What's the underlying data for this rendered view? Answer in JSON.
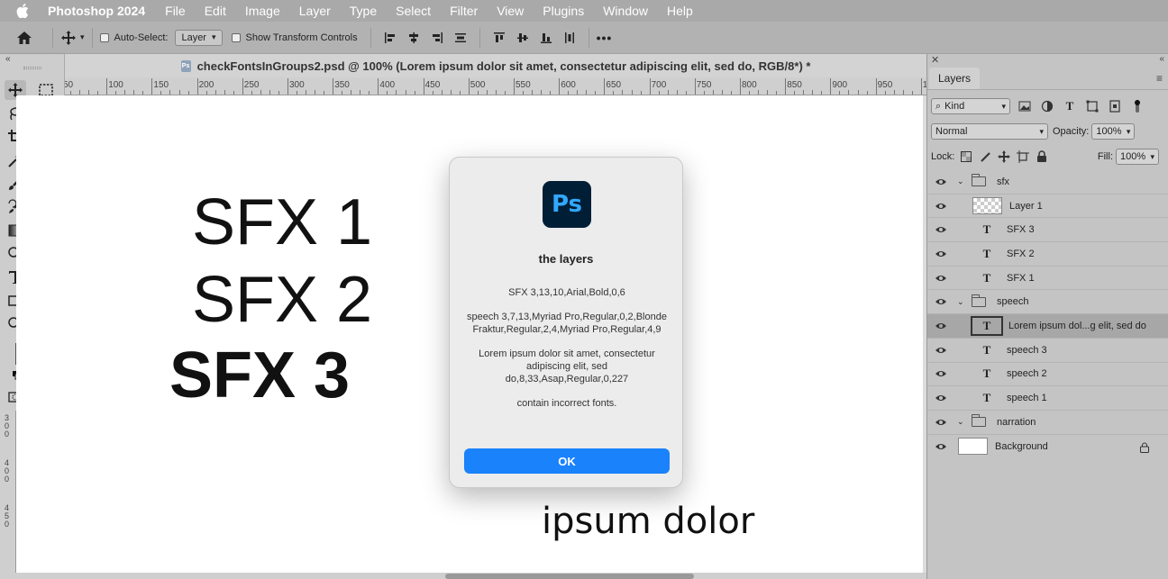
{
  "menubar": {
    "app_name": "Photoshop 2024",
    "items": [
      "File",
      "Edit",
      "Image",
      "Layer",
      "Type",
      "Select",
      "Filter",
      "View",
      "Plugins",
      "Window",
      "Help"
    ]
  },
  "options_bar": {
    "auto_select_label": "Auto-Select:",
    "auto_select_value": "Layer",
    "transform_controls_label": "Show Transform Controls",
    "more_label": "•••"
  },
  "document": {
    "tab_title": "checkFontsInGroups2.psd @ 100% (Lorem ipsum dolor sit amet, consectetur adipiscing elit, sed do, RGB/8*) *",
    "ruler_labels": [
      "50",
      "100",
      "150",
      "200",
      "250",
      "300",
      "350",
      "400",
      "450",
      "500",
      "550",
      "600",
      "650",
      "700",
      "750",
      "800",
      "850",
      "900",
      "950",
      "10"
    ],
    "vruler_labels": [
      "3",
      "0",
      "0",
      "4",
      "0",
      "0",
      "4",
      "5",
      "0"
    ],
    "canvas_texts": {
      "sfx1": "SFX 1",
      "sfx2": "SFX 2",
      "sfx3": "SFX 3",
      "lorem_fragment": "ipsum dolor"
    }
  },
  "colors": {
    "foreground": "#d9a05a",
    "background": "#ffffff",
    "accent": "#1a82fb",
    "ps_logo_bg": "#001e36",
    "ps_logo_text": "#31a8ff"
  },
  "layers_panel": {
    "tab": "Layers",
    "filter_kind": "Kind",
    "blend_mode": "Normal",
    "opacity_label": "Opacity:",
    "opacity_value": "100%",
    "lock_label": "Lock:",
    "fill_label": "Fill:",
    "fill_value": "100%",
    "layers": [
      {
        "name": "sfx",
        "kind": "group"
      },
      {
        "name": "Layer 1",
        "kind": "pixel"
      },
      {
        "name": "SFX 3",
        "kind": "text"
      },
      {
        "name": "SFX 2",
        "kind": "text"
      },
      {
        "name": "SFX 1",
        "kind": "text"
      },
      {
        "name": "speech",
        "kind": "group"
      },
      {
        "name": "Lorem ipsum dol...g elit, sed do",
        "kind": "text",
        "selected": true
      },
      {
        "name": "speech 3",
        "kind": "text"
      },
      {
        "name": "speech 2",
        "kind": "text"
      },
      {
        "name": "speech 1",
        "kind": "text"
      },
      {
        "name": "narration",
        "kind": "group"
      },
      {
        "name": "Background",
        "kind": "background"
      }
    ]
  },
  "dialog": {
    "logo_text": "Ps",
    "title": "the layers",
    "paragraphs": [
      "SFX 3,13,10,Arial,Bold,0,6",
      "speech 3,7,13,Myriad Pro,Regular,0,2,Blonde Fraktur,Regular,2,4,Myriad Pro,Regular,4,9",
      "Lorem ipsum dolor sit amet, consectetur adipiscing elit, sed do,8,33,Asap,Regular,0,227",
      "contain incorrect fonts."
    ],
    "ok_label": "OK"
  }
}
